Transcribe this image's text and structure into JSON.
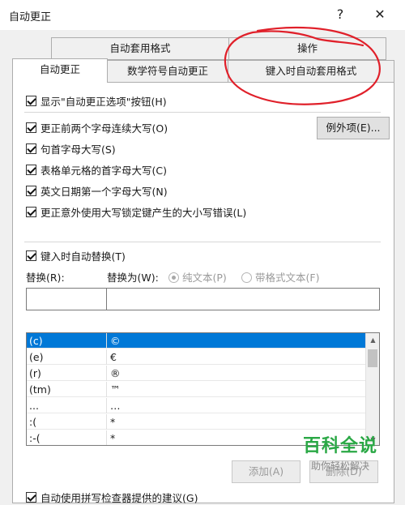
{
  "window": {
    "title": "自动更正",
    "help_symbol": "?",
    "close_symbol": "✕"
  },
  "tabs_row1": [
    {
      "label": "自动套用格式"
    },
    {
      "label": "操作"
    }
  ],
  "tabs_row2": [
    {
      "label": "自动更正",
      "active": true
    },
    {
      "label": "数学符号自动更正"
    },
    {
      "label": "键入时自动套用格式"
    }
  ],
  "options": {
    "show_buttons": "显示\"自动更正选项\"按钮(H)",
    "two_initial_caps": "更正前两个字母连续大写(O)",
    "cap_first_sentence": "句首字母大写(S)",
    "cap_first_table_cell": "表格单元格的首字母大写(C)",
    "cap_english_days": "英文日期第一个字母大写(N)",
    "correct_caps_lock": "更正意外使用大写锁定键产生的大小写错误(L)",
    "exceptions_button": "例外项(E)..."
  },
  "replace": {
    "checkbox_label": "键入时自动替换(T)",
    "replace_label": "替换(R):",
    "with_label": "替换为(W):",
    "plain_text": "纯文本(P)",
    "formatted_text": "带格式文本(F)",
    "replace_value": "",
    "with_value": ""
  },
  "entries": [
    {
      "from": "(c)",
      "to": "©",
      "selected": true
    },
    {
      "from": "(e)",
      "to": "€"
    },
    {
      "from": "(r)",
      "to": "®"
    },
    {
      "from": "(tm)",
      "to": "™"
    },
    {
      "from": "...",
      "to": "…"
    },
    {
      "from": ":(",
      "to": "*"
    },
    {
      "from": ":-(",
      "to": "*"
    }
  ],
  "buttons": {
    "add": "添加(A)",
    "delete": "删除(D)"
  },
  "bottom_partial": "自动使用拼写检查器提供的建议(G)",
  "watermark": {
    "title": "百科全说",
    "subtitle": "助你轻松解决",
    "color": "#2aa845"
  },
  "annotation": {
    "color": "#e0202a"
  }
}
